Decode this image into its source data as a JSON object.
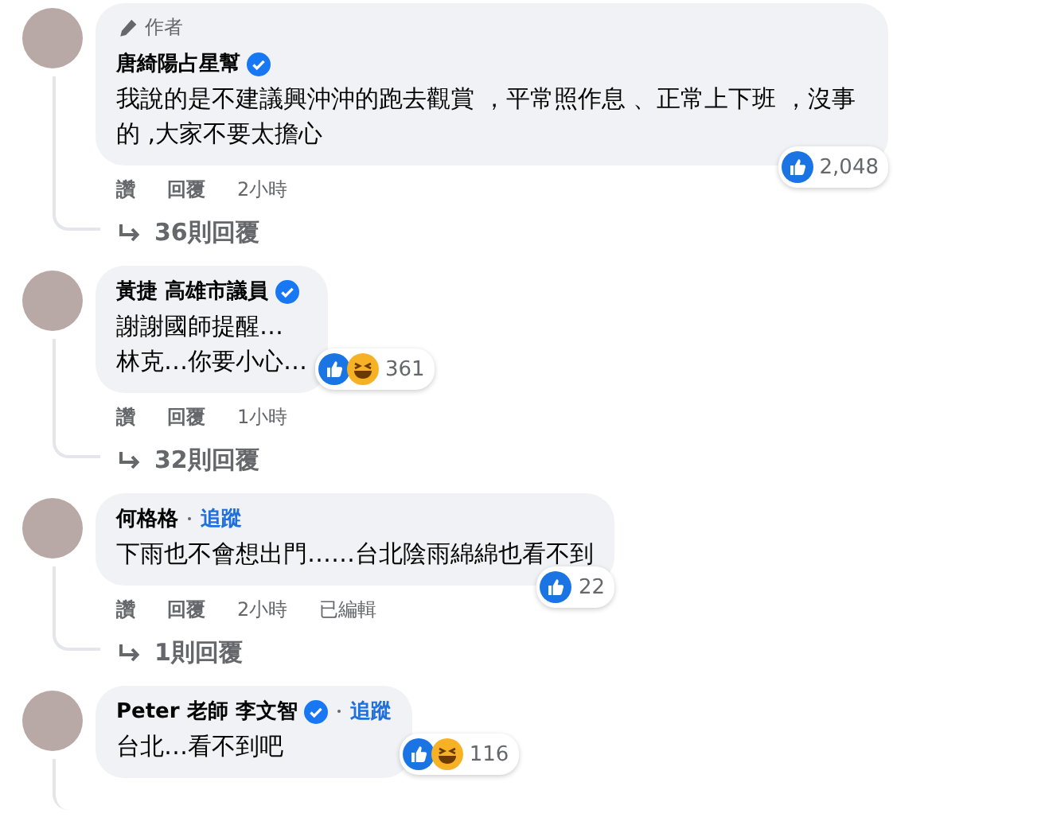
{
  "comments": [
    {
      "author": "唐綺陽占星幫",
      "author_tag": "作者",
      "verified": true,
      "text": "我說的是不建議興沖沖的跑去觀賞 ，平常照作息 、正常上下班 ，沒事的 ,大家不要太擔心",
      "reactions": [
        {
          "kind": "like"
        }
      ],
      "reaction_count": "2,048",
      "actions": [
        {
          "kind": "link",
          "label": "讚"
        },
        {
          "kind": "link",
          "label": "回覆"
        },
        {
          "kind": "meta",
          "label": "2小時"
        }
      ],
      "replies": "36則回覆"
    },
    {
      "author": "黃捷 高雄市議員",
      "verified": true,
      "text": "謝謝國師提醒…\n林克…你要小心…",
      "reactions": [
        {
          "kind": "like"
        },
        {
          "kind": "haha"
        }
      ],
      "reaction_count": "361",
      "actions": [
        {
          "kind": "link",
          "label": "讚"
        },
        {
          "kind": "link",
          "label": "回覆"
        },
        {
          "kind": "meta",
          "label": "1小時"
        }
      ],
      "replies": "32則回覆"
    },
    {
      "author": "何格格",
      "verified": false,
      "follow": "追蹤",
      "text": "下雨也不會想出門……台北陰雨綿綿也看不到",
      "reactions": [
        {
          "kind": "like"
        }
      ],
      "reaction_count": "22",
      "actions": [
        {
          "kind": "link",
          "label": "讚"
        },
        {
          "kind": "link",
          "label": "回覆"
        },
        {
          "kind": "meta",
          "label": "2小時"
        },
        {
          "kind": "meta",
          "label": "已編輯"
        }
      ],
      "replies": "1則回覆"
    },
    {
      "author": "Peter 老師 李文智",
      "verified": true,
      "follow": "追蹤",
      "text": "台北…看不到吧",
      "reactions": [
        {
          "kind": "like"
        },
        {
          "kind": "haha"
        }
      ],
      "reaction_count": "116"
    }
  ]
}
